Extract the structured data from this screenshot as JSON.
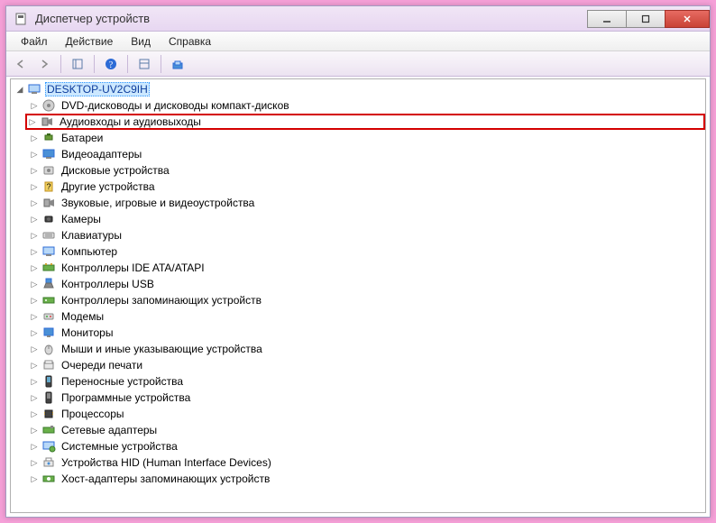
{
  "window": {
    "title": "Диспетчер устройств"
  },
  "menu": {
    "file": "Файл",
    "action": "Действие",
    "view": "Вид",
    "help": "Справка"
  },
  "tree": {
    "root": "DESKTOP-UV2C9IH",
    "items": [
      "DVD-дисководы и дисководы компакт-дисков",
      "Аудиовходы и аудиовыходы",
      "Батареи",
      "Видеоадаптеры",
      "Дисковые устройства",
      "Другие устройства",
      "Звуковые, игровые и видеоустройства",
      "Камеры",
      "Клавиатуры",
      "Компьютер",
      "Контроллеры IDE ATA/ATAPI",
      "Контроллеры USB",
      "Контроллеры запоминающих устройств",
      "Модемы",
      "Мониторы",
      "Мыши и иные указывающие устройства",
      "Очереди печати",
      "Переносные устройства",
      "Программные устройства",
      "Процессоры",
      "Сетевые адаптеры",
      "Системные устройства",
      "Устройства HID (Human Interface Devices)",
      "Хост-адаптеры запоминающих устройств"
    ]
  }
}
